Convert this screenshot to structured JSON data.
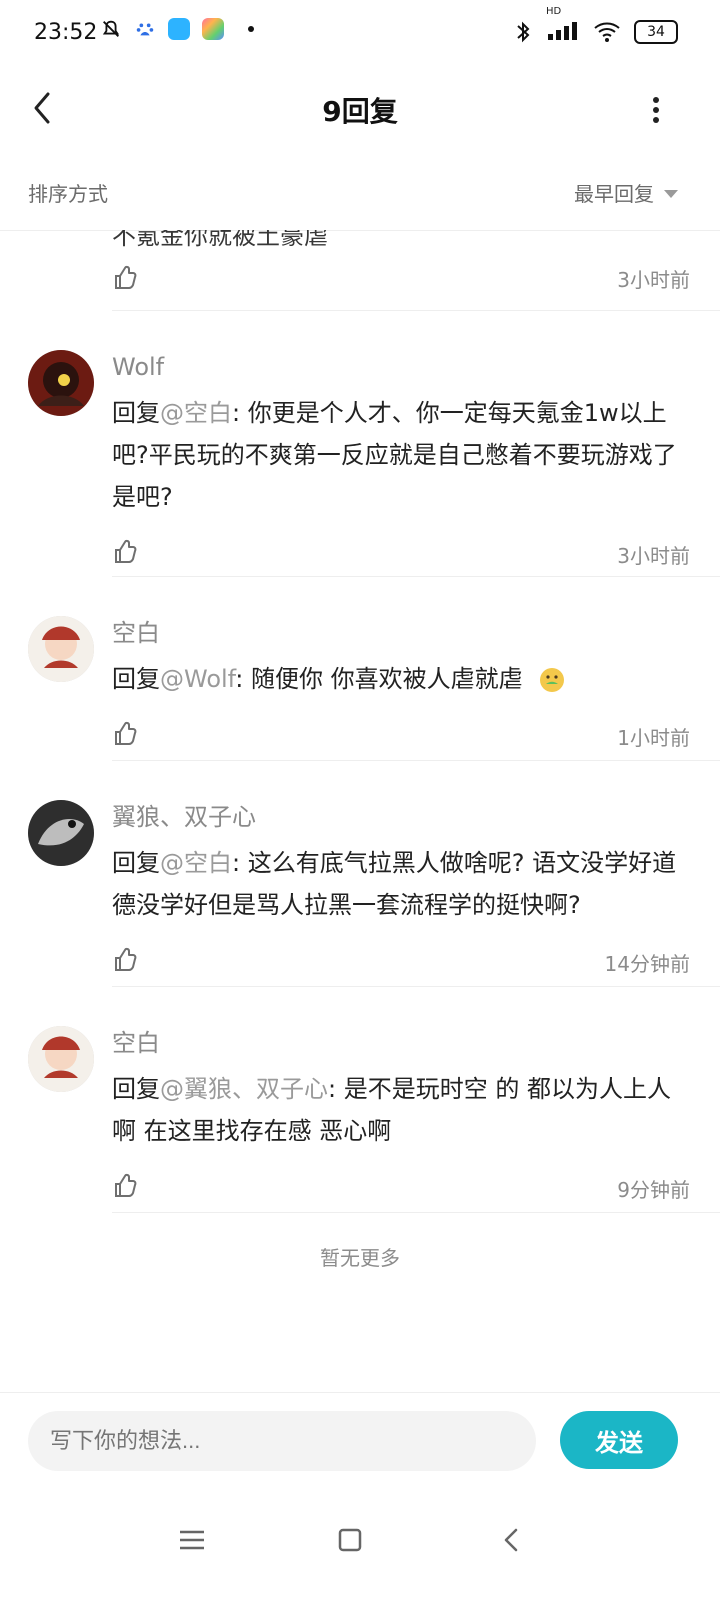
{
  "status_bar": {
    "time": "23:52",
    "battery": "34",
    "signal_label": "HD",
    "icons": [
      "mute-icon",
      "baidu-icon",
      "app-icon-blue",
      "app-icon-game",
      "dot-icon",
      "bluetooth-icon",
      "signal-icon",
      "wifi-icon",
      "battery-icon"
    ]
  },
  "header": {
    "title": "9回复",
    "back_icon": "back-icon",
    "more_icon": "more-icon"
  },
  "sort": {
    "label": "排序方式",
    "value": "最早回复"
  },
  "previous_item": {
    "text": "不氪金你就被土豪虐",
    "time": "3小时前"
  },
  "replies": [
    {
      "username": "Wolf",
      "prefix": "回复",
      "mention": "@空白",
      "text": ": 你更是个人才、你一定每天氪金1w以上吧?平民玩的不爽第一反应就是自己憋着不要玩游戏了是吧?",
      "time": "3小时前"
    },
    {
      "username": "空白",
      "prefix": "回复",
      "mention": "@Wolf",
      "text": ": 随便你 你喜欢被人虐就虐",
      "emoji": "nauseated-face",
      "time": "1小时前"
    },
    {
      "username": "翼狼、双子心",
      "prefix": "回复",
      "mention": "@空白",
      "text": ": 这么有底气拉黑人做啥呢? 语文没学好道德没学好但是骂人拉黑一套流程学的挺快啊?",
      "time": "14分钟前"
    },
    {
      "username": "空白",
      "prefix": "回复",
      "mention": "@翼狼、双子心",
      "text": ": 是不是玩时空 的 都以为人上人啊  在这里找存在感 恶心啊",
      "time": "9分钟前"
    }
  ],
  "footer_text": "暂无更多",
  "composer": {
    "placeholder": "写下你的想法...",
    "send_label": "发送"
  },
  "colors": {
    "accent": "#1bb6c6",
    "muted_text": "#8a8a8a",
    "divider": "#eeeeee"
  }
}
